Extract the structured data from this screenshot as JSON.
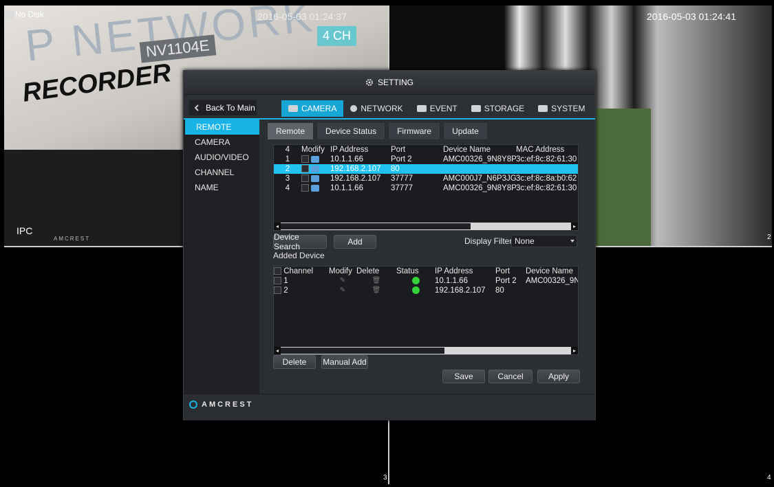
{
  "camera_panes": {
    "tl": {
      "status": "No Disk",
      "timestamp": "2016-05-03 01:24:37",
      "label": "IPC",
      "watermark": "P NETWORK",
      "product": "NV1104E",
      "recorder": "RECORDER",
      "box_label": "4 CH"
    },
    "tr": {
      "timestamp": "2016-05-03 01:24:41",
      "number": "2"
    },
    "bl": {
      "number": "3"
    },
    "br": {
      "number": "4"
    },
    "brand": "AMCREST"
  },
  "dialog": {
    "title": "SETTING",
    "back_label": "Back To Main",
    "main_tabs": [
      {
        "label": "CAMERA",
        "icon": "camera-icon",
        "active": true
      },
      {
        "label": "NETWORK",
        "icon": "network-icon"
      },
      {
        "label": "EVENT",
        "icon": "event-icon"
      },
      {
        "label": "STORAGE",
        "icon": "storage-icon"
      },
      {
        "label": "SYSTEM",
        "icon": "system-icon"
      }
    ],
    "sidebar": [
      "REMOTE",
      "CAMERA",
      "AUDIO/VIDEO",
      "CHANNEL NAME"
    ],
    "sub_tabs": [
      "Remote",
      "Device Status",
      "Firmware",
      "Update"
    ],
    "search_table": {
      "headers": [
        "4",
        "Modify",
        "IP Address",
        "Port",
        "Device Name",
        "MAC Address"
      ],
      "rows": [
        {
          "n": "1",
          "ip": "10.1.1.66",
          "port": "Port 2",
          "name": "AMC00326_9N8Y8P",
          "mac": "3c:ef:8c:82:61:30",
          "selected": false
        },
        {
          "n": "2",
          "ip": "192.168.2.107",
          "port": "80",
          "name": "",
          "mac": "",
          "selected": true
        },
        {
          "n": "3",
          "ip": "192.168.2.107",
          "port": "37777",
          "name": "AMC000J7_N6P3JG",
          "mac": "3c:ef:8c:8a:b0:62",
          "selected": false
        },
        {
          "n": "4",
          "ip": "10.1.1.66",
          "port": "37777",
          "name": "AMC00326_9N8Y8P",
          "mac": "3c:ef:8c:82:61:30",
          "selected": false
        }
      ]
    },
    "device_search_label": "Device Search",
    "add_label": "Add",
    "display_filter_label": "Display Filter",
    "display_filter_value": "None",
    "added_device_label": "Added Device",
    "added_table": {
      "headers": [
        "Channel",
        "Modify",
        "Delete",
        "Status",
        "IP Address",
        "Port",
        "Device Name"
      ],
      "rows": [
        {
          "ch": "1",
          "ip": "10.1.1.66",
          "port": "Port 2",
          "name": "AMC00326_9N"
        },
        {
          "ch": "2",
          "ip": "192.168.2.107",
          "port": "80",
          "name": ""
        }
      ]
    },
    "delete_label": "Delete",
    "manual_add_label": "Manual Add",
    "save_label": "Save",
    "cancel_label": "Cancel",
    "apply_label": "Apply",
    "brand": "AMCREST",
    "accent_color": "#19b3e6",
    "status_color": "#34d23b"
  }
}
